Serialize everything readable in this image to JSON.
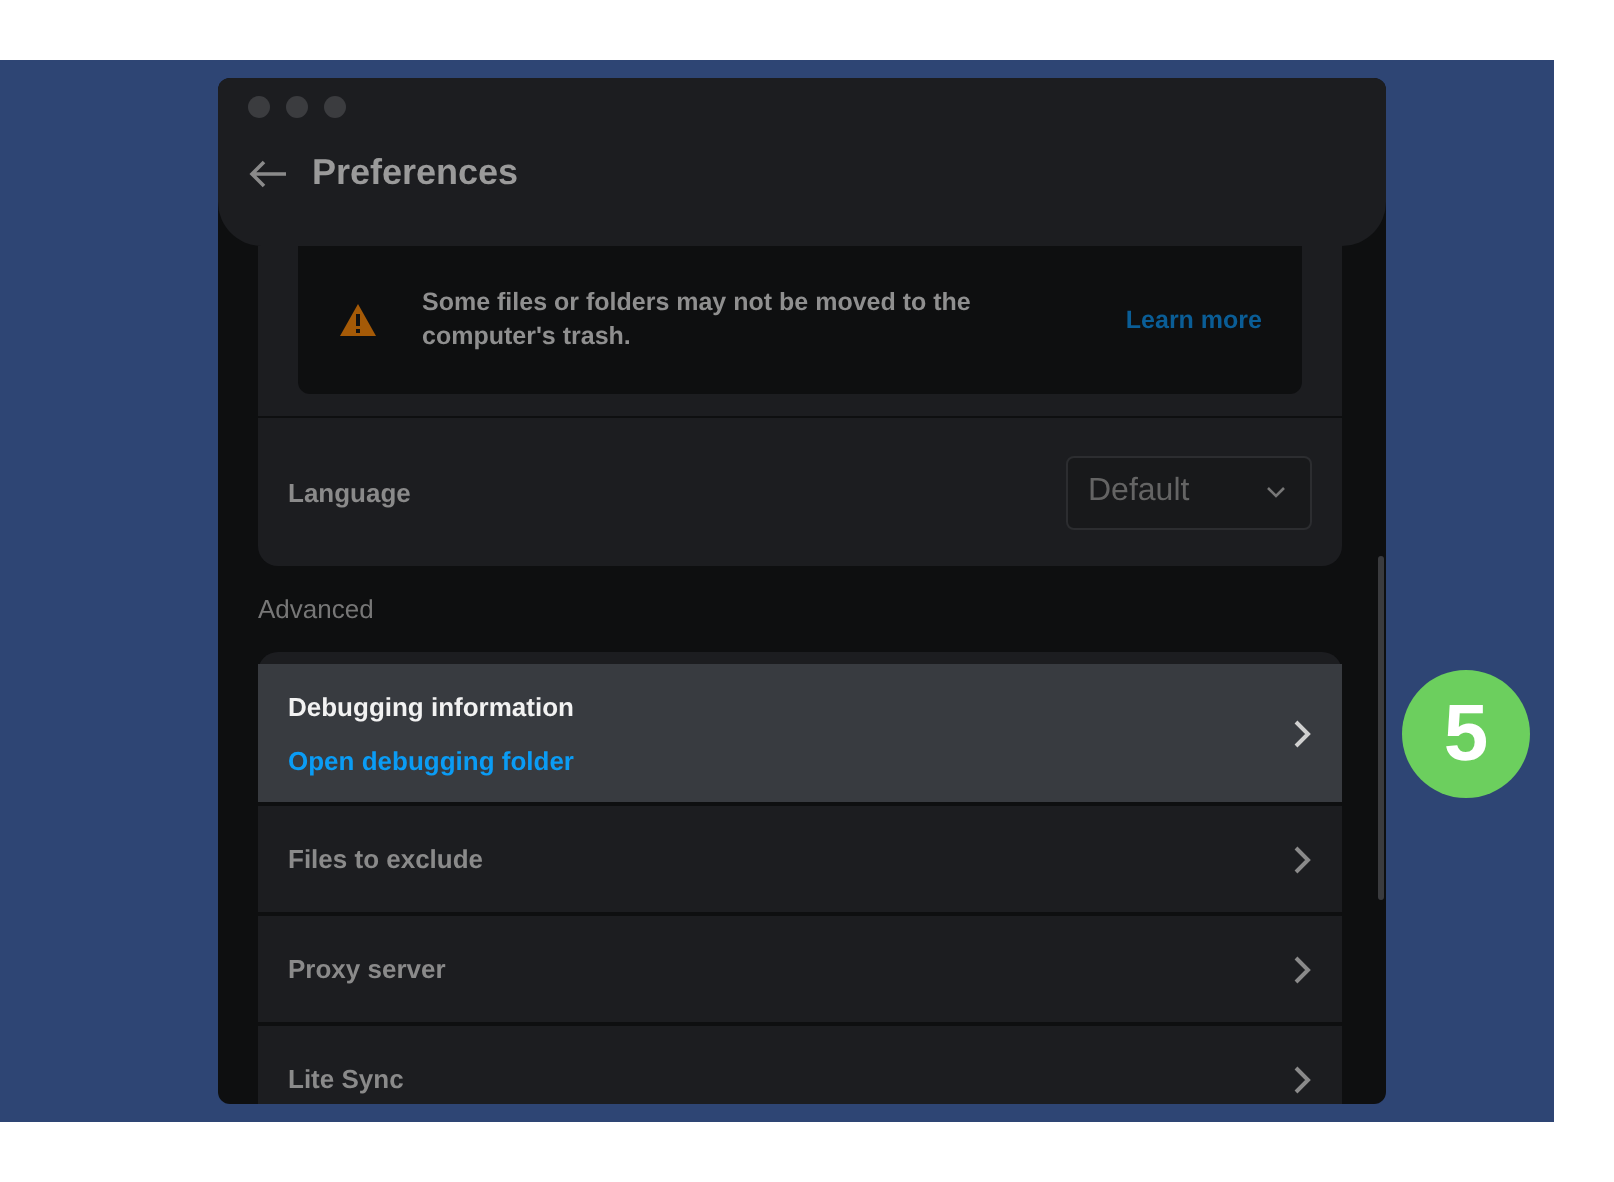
{
  "window": {
    "title": "Preferences"
  },
  "notice": {
    "text": "Some files or folders may not be moved to the computer's trash.",
    "link": "Learn more"
  },
  "language": {
    "label": "Language",
    "value": "Default"
  },
  "advanced": {
    "heading": "Advanced",
    "rows": [
      {
        "title": "Debugging information",
        "link": "Open debugging folder",
        "highlighted": true
      },
      {
        "title": "Files to exclude",
        "highlighted": false
      },
      {
        "title": "Proxy server",
        "highlighted": false
      },
      {
        "title": "Lite Sync",
        "highlighted": false
      }
    ]
  },
  "badge": {
    "text": "5"
  }
}
